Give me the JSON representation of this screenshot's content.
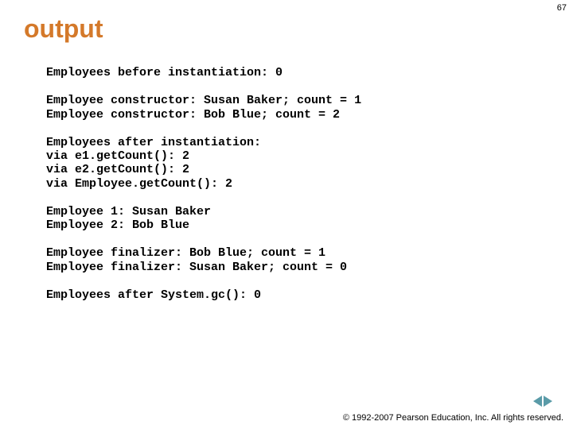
{
  "page_number": "67",
  "title": "output",
  "output": {
    "block1": "Employees before instantiation: 0",
    "block2_line1": "Employee constructor: Susan Baker; count = 1",
    "block2_line2": "Employee constructor: Bob Blue; count = 2",
    "block3_line1": "Employees after instantiation:",
    "block3_line2": "via e1.getCount(): 2",
    "block3_line3": "via e2.getCount(): 2",
    "block3_line4": "via Employee.getCount(): 2",
    "block4_line1": "Employee 1: Susan Baker",
    "block4_line2": "Employee 2: Bob Blue",
    "block5_line1": "Employee finalizer: Bob Blue; count = 1",
    "block5_line2": "Employee finalizer: Susan Baker; count = 0",
    "block6": "Employees after System.gc(): 0"
  },
  "footer": "© 1992-2007 Pearson Education, Inc.  All rights reserved."
}
